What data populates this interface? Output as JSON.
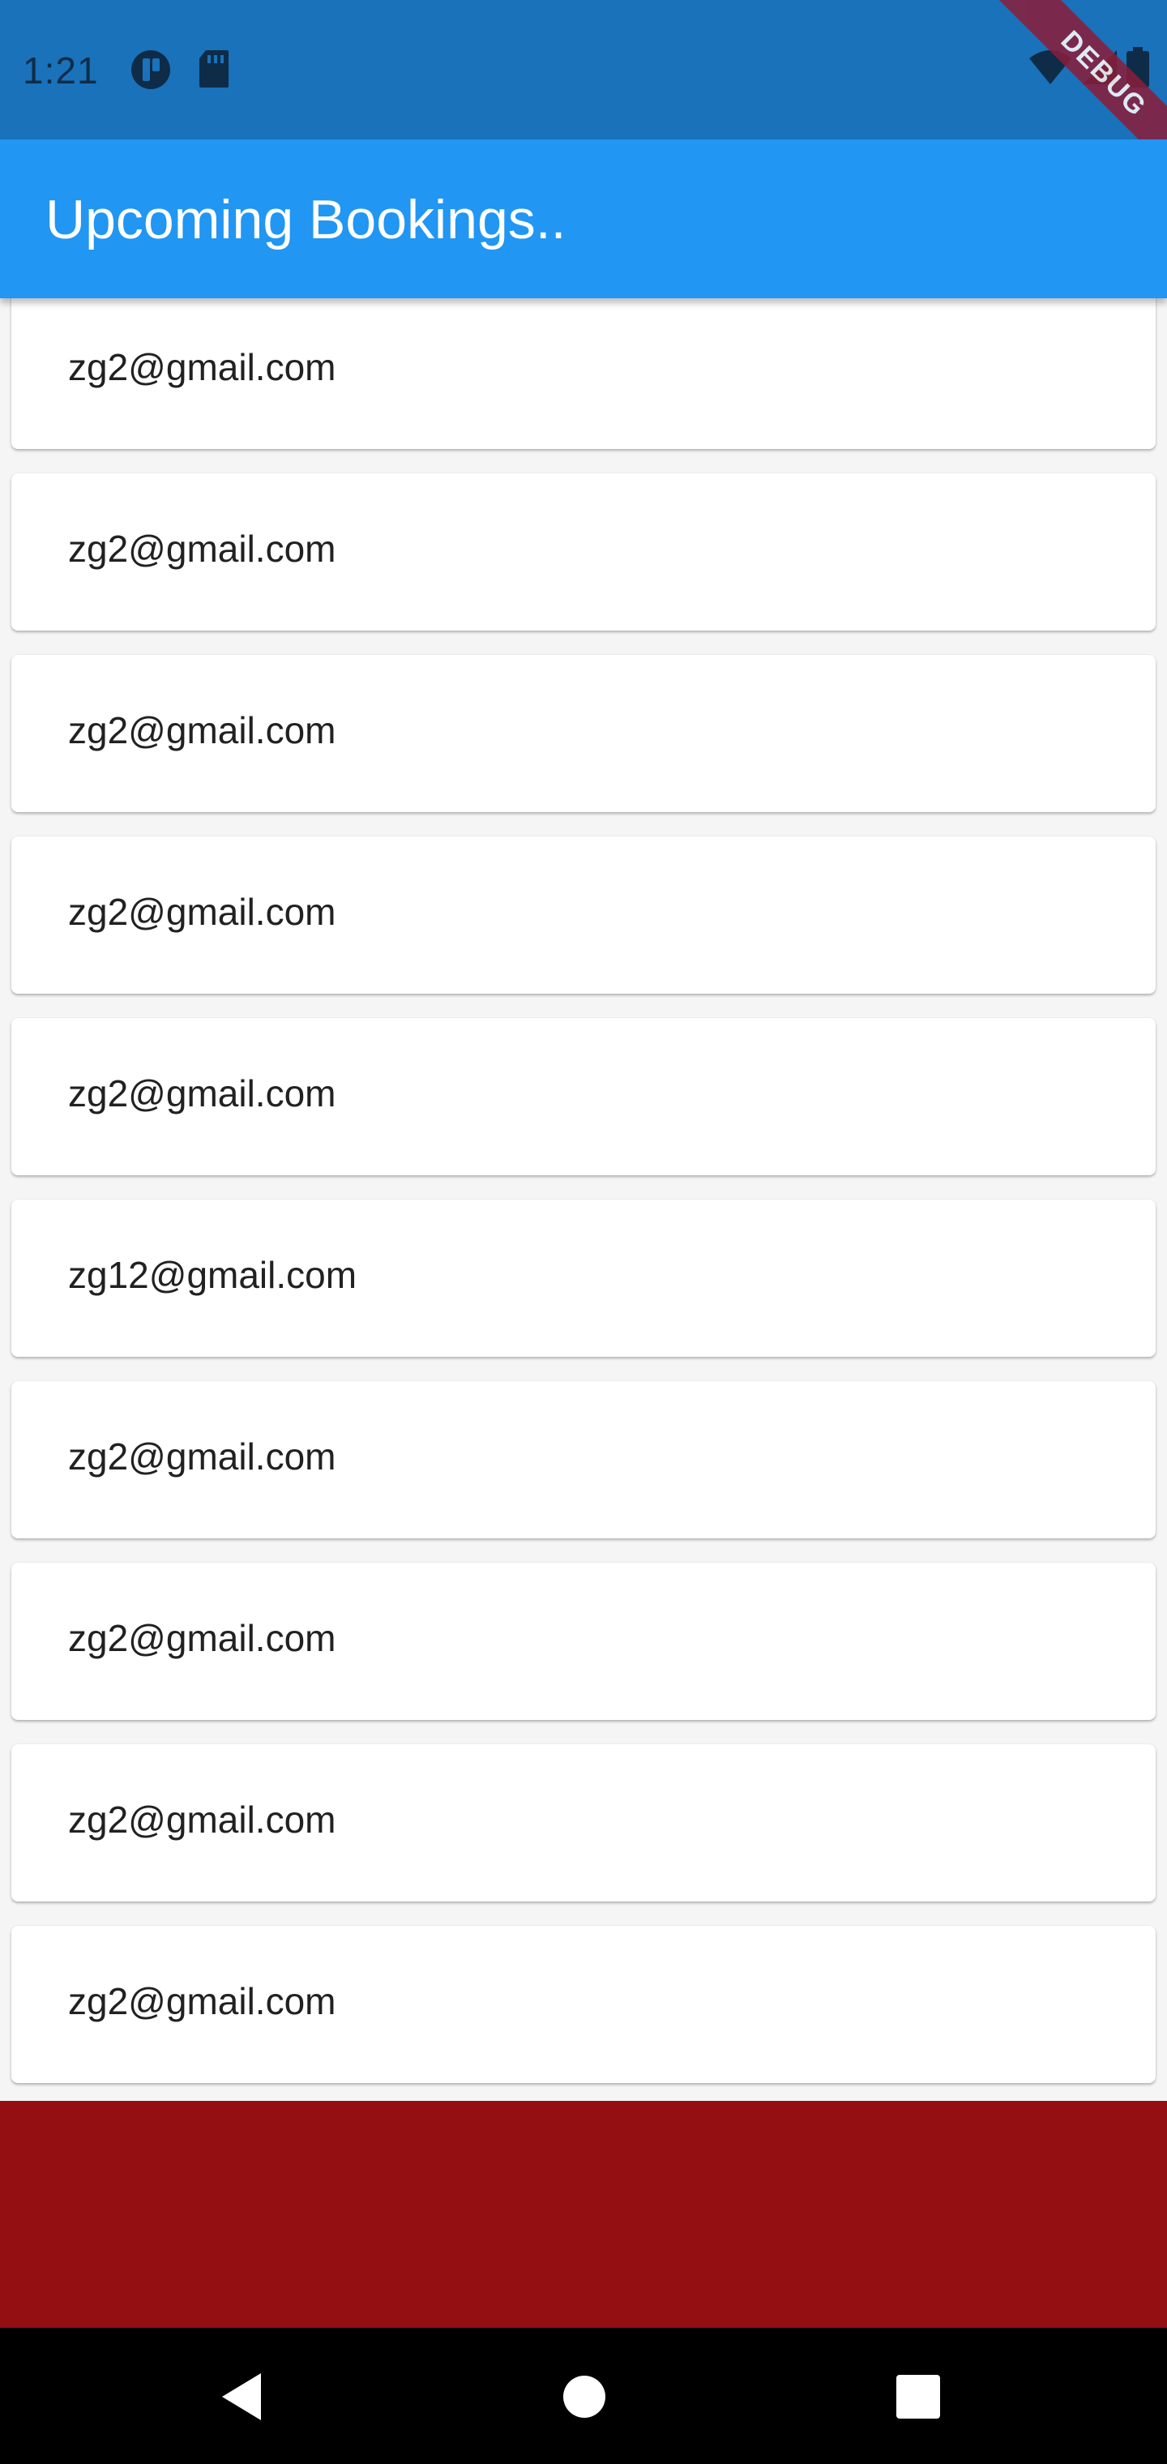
{
  "status_bar": {
    "time": "1:21",
    "left_icons": [
      "app-circle-icon",
      "sd-card-icon"
    ],
    "right_icons": [
      "wifi-icon",
      "cell-signal-icon",
      "battery-icon"
    ]
  },
  "debug_banner": {
    "label": "DEBUG"
  },
  "app_bar": {
    "title": "Upcoming Bookings.."
  },
  "bookings": [
    {
      "email": "zg2@gmail.com"
    },
    {
      "email": "zg2@gmail.com"
    },
    {
      "email": "zg2@gmail.com"
    },
    {
      "email": "zg2@gmail.com"
    },
    {
      "email": "zg2@gmail.com"
    },
    {
      "email": "zg12@gmail.com"
    },
    {
      "email": "zg2@gmail.com"
    },
    {
      "email": "zg2@gmail.com"
    },
    {
      "email": "zg2@gmail.com"
    },
    {
      "email": "zg2@gmail.com"
    }
  ],
  "colors": {
    "status_bar": "#1a72ba",
    "app_bar": "#2196f3",
    "footer": "#940f12",
    "nav_bar": "#000000"
  },
  "nav_bar": {
    "buttons": [
      "back-icon",
      "home-icon",
      "recents-icon"
    ]
  }
}
